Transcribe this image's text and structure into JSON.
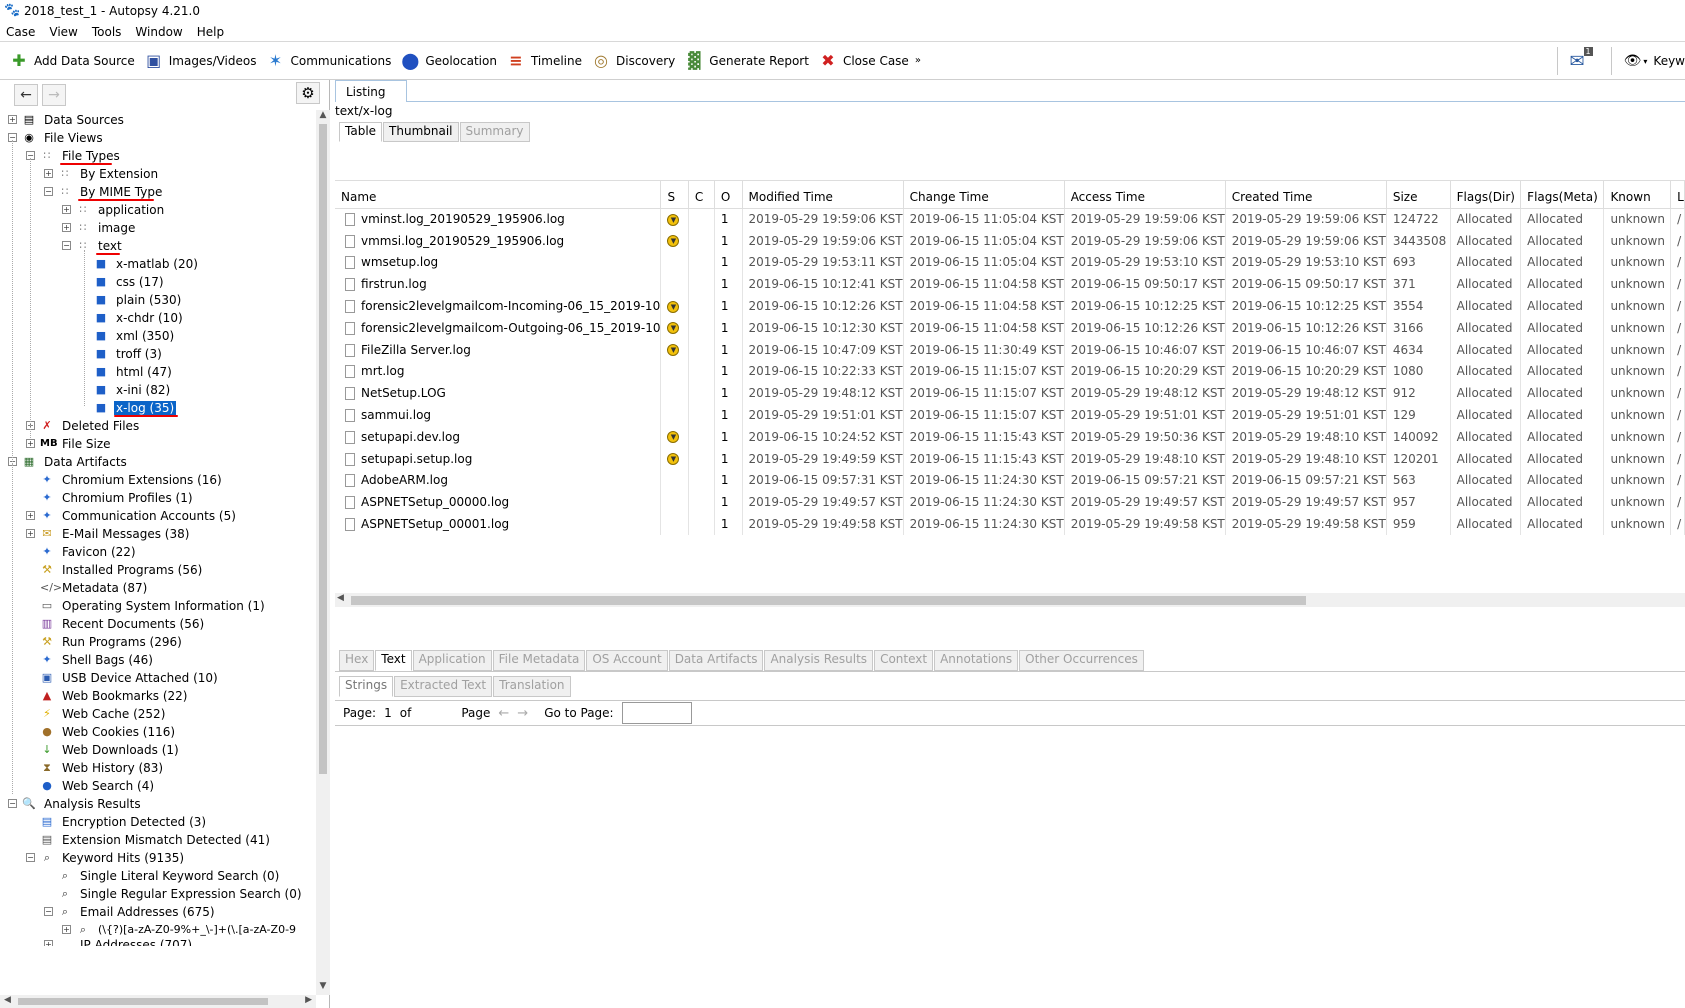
{
  "window": {
    "title": "2018_test_1 - Autopsy 4.21.0"
  },
  "menu": [
    "Case",
    "View",
    "Tools",
    "Window",
    "Help"
  ],
  "toolbar": {
    "add_data_source": "Add Data Source",
    "images_videos": "Images/Videos",
    "communications": "Communications",
    "geolocation": "Geolocation",
    "timeline": "Timeline",
    "discovery": "Discovery",
    "generate_report": "Generate Report",
    "close_case": "Close Case",
    "keyword_search": "Keyw",
    "notification_count": "1"
  },
  "tree": {
    "data_sources": "Data Sources",
    "file_views": "File Views",
    "file_types": "File Types",
    "by_extension": "By Extension",
    "by_mime_type": "By MIME Type",
    "application": "application",
    "image": "image",
    "text": "text",
    "text_children": [
      "x-matlab (20)",
      "css (17)",
      "plain (530)",
      "x-chdr (10)",
      "xml (350)",
      "troff (3)",
      "html (47)",
      "x-ini (82)",
      "x-log (35)"
    ],
    "deleted_files": "Deleted Files",
    "file_size": "File Size",
    "file_size_badge": "MB",
    "data_artifacts": "Data Artifacts",
    "artifacts": [
      "Chromium Extensions (16)",
      "Chromium Profiles (1)",
      "Communication Accounts (5)",
      "E-Mail Messages (38)",
      "Favicon (22)",
      "Installed Programs (56)",
      "Metadata (87)",
      "Operating System Information (1)",
      "Recent Documents (56)",
      "Run Programs (296)",
      "Shell Bags (46)",
      "USB Device Attached (10)",
      "Web Bookmarks (22)",
      "Web Cache (252)",
      "Web Cookies (116)",
      "Web Downloads (1)",
      "Web History (83)",
      "Web Search (4)"
    ],
    "analysis_results": "Analysis Results",
    "encryption_detected": "Encryption Detected (3)",
    "extension_mismatch": "Extension Mismatch Detected (41)",
    "keyword_hits": "Keyword Hits (9135)",
    "single_literal": "Single Literal Keyword Search (0)",
    "single_regex": "Single Regular Expression Search (0)",
    "email_addresses": "Email Addresses (675)",
    "email_regex": "(\\{?)[a-zA-Z0-9%+_\\-]+(\\.[a-zA-Z0-9",
    "ip_addresses": "IP Addresses (707)"
  },
  "listing": {
    "tab": "Listing",
    "path": "text/x-log",
    "view_tabs": [
      "Table",
      "Thumbnail",
      "Summary"
    ],
    "columns": [
      "Name",
      "S",
      "C",
      "O",
      "Modified Time",
      "Change Time",
      "Access Time",
      "Created Time",
      "Size",
      "Flags(Dir)",
      "Flags(Meta)",
      "Known",
      "L"
    ],
    "rows": [
      {
        "name": "vminst.log_20190529_195906.log",
        "score": true,
        "o": "1",
        "modified": "2019-05-29 19:59:06 KST",
        "change": "2019-06-15 11:05:04 KST",
        "access": "2019-05-29 19:59:06 KST",
        "created": "2019-05-29 19:59:06 KST",
        "size": "124722",
        "flags_dir": "Allocated",
        "flags_meta": "Allocated",
        "known": "unknown",
        "l": "/"
      },
      {
        "name": "vmmsi.log_20190529_195906.log",
        "score": true,
        "o": "1",
        "modified": "2019-05-29 19:59:06 KST",
        "change": "2019-06-15 11:05:04 KST",
        "access": "2019-05-29 19:59:06 KST",
        "created": "2019-05-29 19:59:06 KST",
        "size": "3443508",
        "flags_dir": "Allocated",
        "flags_meta": "Allocated",
        "known": "unknown",
        "l": "/"
      },
      {
        "name": "wmsetup.log",
        "score": false,
        "o": "1",
        "modified": "2019-05-29 19:53:11 KST",
        "change": "2019-06-15 11:05:04 KST",
        "access": "2019-05-29 19:53:10 KST",
        "created": "2019-05-29 19:53:10 KST",
        "size": "693",
        "flags_dir": "Allocated",
        "flags_meta": "Allocated",
        "known": "unknown",
        "l": "/"
      },
      {
        "name": "firstrun.log",
        "score": false,
        "o": "1",
        "modified": "2019-06-15 10:12:41 KST",
        "change": "2019-06-15 11:04:58 KST",
        "access": "2019-06-15 09:50:17 KST",
        "created": "2019-06-15 09:50:17 KST",
        "size": "371",
        "flags_dir": "Allocated",
        "flags_meta": "Allocated",
        "known": "unknown",
        "l": "/"
      },
      {
        "name": "forensic2levelgmailcom-Incoming-06_15_2019-10",
        "score": true,
        "o": "1",
        "modified": "2019-06-15 10:12:26 KST",
        "change": "2019-06-15 11:04:58 KST",
        "access": "2019-06-15 10:12:25 KST",
        "created": "2019-06-15 10:12:25 KST",
        "size": "3554",
        "flags_dir": "Allocated",
        "flags_meta": "Allocated",
        "known": "unknown",
        "l": "/"
      },
      {
        "name": "forensic2levelgmailcom-Outgoing-06_15_2019-10",
        "score": true,
        "o": "1",
        "modified": "2019-06-15 10:12:30 KST",
        "change": "2019-06-15 11:04:58 KST",
        "access": "2019-06-15 10:12:26 KST",
        "created": "2019-06-15 10:12:26 KST",
        "size": "3166",
        "flags_dir": "Allocated",
        "flags_meta": "Allocated",
        "known": "unknown",
        "l": "/"
      },
      {
        "name": "FileZilla Server.log",
        "score": true,
        "o": "1",
        "modified": "2019-06-15 10:47:09 KST",
        "change": "2019-06-15 11:30:49 KST",
        "access": "2019-06-15 10:46:07 KST",
        "created": "2019-06-15 10:46:07 KST",
        "size": "4634",
        "flags_dir": "Allocated",
        "flags_meta": "Allocated",
        "known": "unknown",
        "l": "/"
      },
      {
        "name": "mrt.log",
        "score": false,
        "o": "1",
        "modified": "2019-06-15 10:22:33 KST",
        "change": "2019-06-15 11:15:07 KST",
        "access": "2019-06-15 10:20:29 KST",
        "created": "2019-06-15 10:20:29 KST",
        "size": "1080",
        "flags_dir": "Allocated",
        "flags_meta": "Allocated",
        "known": "unknown",
        "l": "/"
      },
      {
        "name": "NetSetup.LOG",
        "score": false,
        "o": "1",
        "modified": "2019-05-29 19:48:12 KST",
        "change": "2019-06-15 11:15:07 KST",
        "access": "2019-05-29 19:48:12 KST",
        "created": "2019-05-29 19:48:12 KST",
        "size": "912",
        "flags_dir": "Allocated",
        "flags_meta": "Allocated",
        "known": "unknown",
        "l": "/"
      },
      {
        "name": "sammui.log",
        "score": false,
        "o": "1",
        "modified": "2019-05-29 19:51:01 KST",
        "change": "2019-06-15 11:15:07 KST",
        "access": "2019-05-29 19:51:01 KST",
        "created": "2019-05-29 19:51:01 KST",
        "size": "129",
        "flags_dir": "Allocated",
        "flags_meta": "Allocated",
        "known": "unknown",
        "l": "/"
      },
      {
        "name": "setupapi.dev.log",
        "score": true,
        "o": "1",
        "modified": "2019-06-15 10:24:52 KST",
        "change": "2019-06-15 11:15:43 KST",
        "access": "2019-05-29 19:50:36 KST",
        "created": "2019-05-29 19:48:10 KST",
        "size": "140092",
        "flags_dir": "Allocated",
        "flags_meta": "Allocated",
        "known": "unknown",
        "l": "/"
      },
      {
        "name": "setupapi.setup.log",
        "score": true,
        "o": "1",
        "modified": "2019-05-29 19:49:59 KST",
        "change": "2019-06-15 11:15:43 KST",
        "access": "2019-05-29 19:48:10 KST",
        "created": "2019-05-29 19:48:10 KST",
        "size": "120201",
        "flags_dir": "Allocated",
        "flags_meta": "Allocated",
        "known": "unknown",
        "l": "/"
      },
      {
        "name": "AdobeARM.log",
        "score": false,
        "o": "1",
        "modified": "2019-06-15 09:57:31 KST",
        "change": "2019-06-15 11:24:30 KST",
        "access": "2019-06-15 09:57:21 KST",
        "created": "2019-06-15 09:57:21 KST",
        "size": "563",
        "flags_dir": "Allocated",
        "flags_meta": "Allocated",
        "known": "unknown",
        "l": "/"
      },
      {
        "name": "ASPNETSetup_00000.log",
        "score": false,
        "o": "1",
        "modified": "2019-05-29 19:49:57 KST",
        "change": "2019-06-15 11:24:30 KST",
        "access": "2019-05-29 19:49:57 KST",
        "created": "2019-05-29 19:49:57 KST",
        "size": "957",
        "flags_dir": "Allocated",
        "flags_meta": "Allocated",
        "known": "unknown",
        "l": "/"
      },
      {
        "name": "ASPNETSetup_00001.log",
        "score": false,
        "o": "1",
        "modified": "2019-05-29 19:49:58 KST",
        "change": "2019-06-15 11:24:30 KST",
        "access": "2019-05-29 19:49:58 KST",
        "created": "2019-05-29 19:49:58 KST",
        "size": "959",
        "flags_dir": "Allocated",
        "flags_meta": "Allocated",
        "known": "unknown",
        "l": "/"
      }
    ]
  },
  "content_viewer": {
    "tabs": [
      "Hex",
      "Text",
      "Application",
      "File Metadata",
      "OS Account",
      "Data Artifacts",
      "Analysis Results",
      "Context",
      "Annotations",
      "Other Occurrences"
    ],
    "text_tabs": [
      "Strings",
      "Extracted Text",
      "Translation"
    ],
    "page_label": "Page:",
    "page_value": "1",
    "of_label": "of",
    "page_word": "Page",
    "goto_label": "Go to Page:"
  }
}
